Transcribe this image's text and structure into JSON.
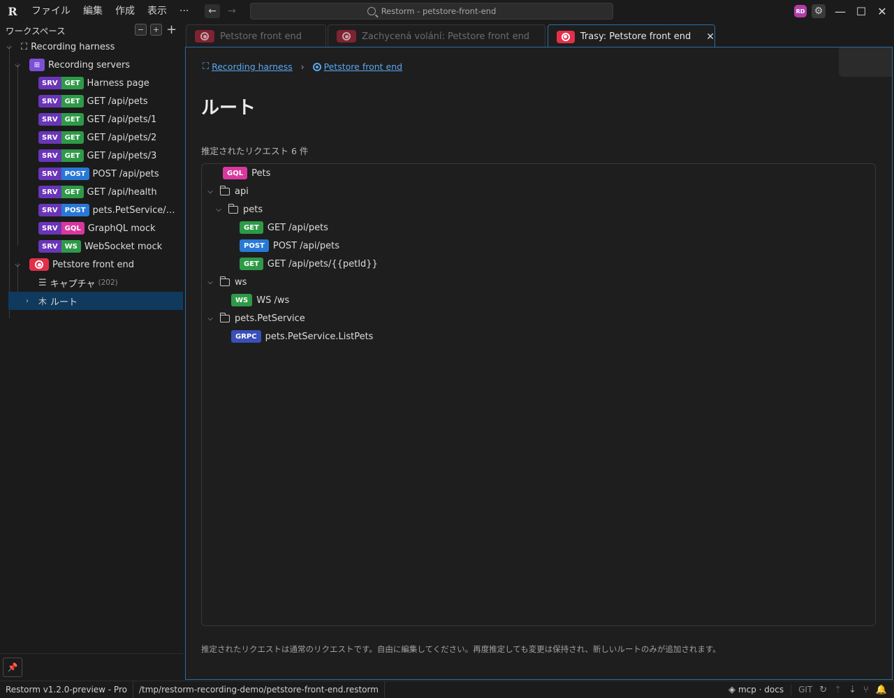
{
  "titlebar": {
    "menus": [
      "ファイル",
      "編集",
      "作成",
      "表示",
      "···"
    ],
    "search_text": "Restorm - petstore-front-end",
    "avatar": "RD"
  },
  "sidebar": {
    "header": "ワークスペース",
    "tree": {
      "harness": "Recording harness",
      "servers_group": "Recording servers",
      "servers": [
        {
          "srv": "SRV",
          "method": "GET",
          "label": "Harness page"
        },
        {
          "srv": "SRV",
          "method": "GET",
          "label": "GET /api/pets"
        },
        {
          "srv": "SRV",
          "method": "GET",
          "label": "GET /api/pets/1"
        },
        {
          "srv": "SRV",
          "method": "GET",
          "label": "GET /api/pets/2"
        },
        {
          "srv": "SRV",
          "method": "GET",
          "label": "GET /api/pets/3"
        },
        {
          "srv": "SRV",
          "method": "POST",
          "label": "POST /api/pets"
        },
        {
          "srv": "SRV",
          "method": "GET",
          "label": "GET /api/health"
        },
        {
          "srv": "SRV",
          "method": "POST",
          "label": "pets.PetService/Li..."
        },
        {
          "srv": "SRV",
          "method": "GQL",
          "label": "GraphQL mock"
        },
        {
          "srv": "SRV",
          "method": "WS",
          "label": "WebSocket mock"
        }
      ],
      "frontend": "Petstore front end",
      "capture_label": "キャプチャ",
      "capture_count": "(202)",
      "routes_label": "ルート"
    }
  },
  "tabs": [
    {
      "label": "Petstore front end"
    },
    {
      "label": "Zachycená volání: Petstore front end"
    },
    {
      "label": "Trasy: Petstore front end",
      "close": "✕"
    }
  ],
  "main": {
    "breadcrumb": [
      "Recording harness",
      "Petstore front end"
    ],
    "title": "ルート",
    "count_text": "推定されたリクエスト 6 件",
    "routes": {
      "gql": {
        "method": "GQL",
        "label": "Pets"
      },
      "api_folder": "api",
      "pets_folder": "pets",
      "get_pets": {
        "method": "GET",
        "label": "GET /api/pets"
      },
      "post_pets": {
        "method": "POST",
        "label": "POST /api/pets"
      },
      "get_pet_id": {
        "method": "GET",
        "label": "GET /api/pets/{{petId}}"
      },
      "ws_folder": "ws",
      "ws_route": {
        "method": "WS",
        "label": "WS /ws"
      },
      "svc_folder": "pets.PetService",
      "grpc_route": {
        "method": "GRPC",
        "label": "pets.PetService.ListPets"
      }
    },
    "footer_note": "推定されたリクエストは通常のリクエストです。自由に編集してください。再度推定しても変更は保持され、新しいルートのみが追加されます。"
  },
  "statusbar": {
    "version": "Restorm v1.2.0-preview - Pro",
    "path": "/tmp/restorm-recording-demo/petstore-front-end.restorm",
    "mcp": "mcp · docs",
    "git": "GIT"
  },
  "colors": {
    "accent": "#2a6ea3",
    "selected": "#0f3a5e",
    "srv": "#6a35b8",
    "get": "#2e9a48",
    "post": "#2879d6",
    "gql": "#d9389e",
    "grpc": "#3a4fb8",
    "record": "#e2304a"
  }
}
